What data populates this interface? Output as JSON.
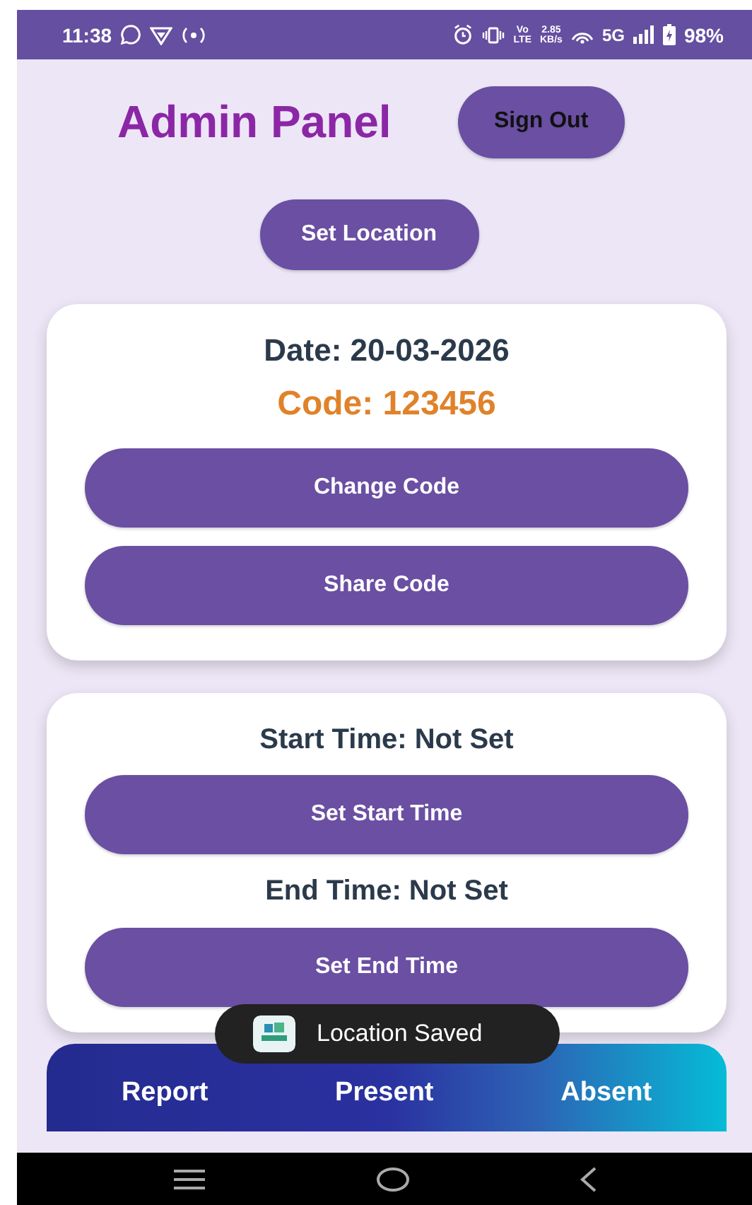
{
  "status_bar": {
    "time": "11:38",
    "volte_top": "Vo",
    "volte_bottom": "LTE",
    "speed": "2.85",
    "speed_unit": "KB/s",
    "network": "5G",
    "battery": "98%"
  },
  "header": {
    "title": "Admin Panel",
    "sign_out": "Sign Out"
  },
  "set_location": "Set Location",
  "code_card": {
    "date": "Date: 20-03-2026",
    "code": "Code: 123456",
    "buttons": [
      "Change Code",
      "Share Code"
    ]
  },
  "time_card": {
    "start": "Start Time: Not Set",
    "start_button": "Set Start Time",
    "end": "End Time: Not Set",
    "end_button": "Set End Time"
  },
  "bottom_tabs": [
    {
      "label": "Report"
    },
    {
      "label": "Present"
    },
    {
      "label": "Absent"
    }
  ],
  "toast": {
    "message": "Location Saved"
  }
}
